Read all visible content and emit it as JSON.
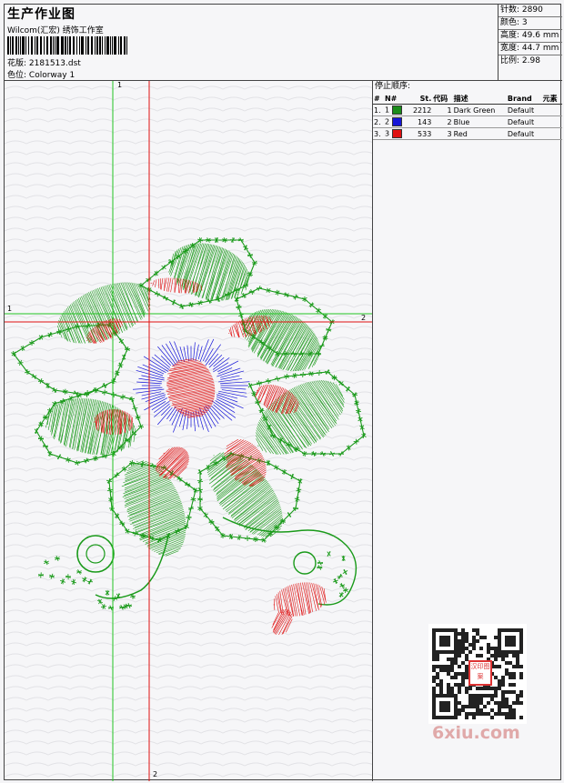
{
  "header": {
    "title": "生产作业图",
    "studio": "Wilcom(汇宏) 绣饰工作室",
    "design_label": "花版:",
    "design_file": "2181513.dst",
    "colorway_label": "色位:",
    "colorway": "Colorway 1"
  },
  "stats": [
    {
      "label": "针数:",
      "value": "2890"
    },
    {
      "label": "颜色:",
      "value": "3"
    },
    {
      "label": "高度:",
      "value": "49.6 mm"
    },
    {
      "label": "宽度:",
      "value": "44.7 mm"
    },
    {
      "label": "比例:",
      "value": "2.98"
    }
  ],
  "stop_sequence": {
    "title": "停止顺序:",
    "columns": [
      "#",
      "N#",
      "St.",
      "代码",
      "描述",
      "Brand",
      "元素"
    ],
    "rows": [
      {
        "index": "1.",
        "n": "1",
        "color": "#1a8c1a",
        "stitches": "2212",
        "code": "1",
        "desc": "Dark Green",
        "brand": "Default"
      },
      {
        "index": "2.",
        "n": "2",
        "color": "#1515d8",
        "stitches": "143",
        "code": "2",
        "desc": "Blue",
        "brand": "Default"
      },
      {
        "index": "3.",
        "n": "3",
        "color": "#e01010",
        "stitches": "533",
        "code": "3",
        "desc": "Red",
        "brand": "Default"
      }
    ]
  },
  "guides": {
    "green_v_label": "1",
    "green_h_label": "1",
    "red_v_label": "2",
    "red_h_label": "2"
  },
  "colors": {
    "green": "#1a9a1a",
    "blue": "#1515d8",
    "red": "#e01010"
  },
  "watermark": {
    "text": "6xiu.com",
    "badge": "汉印图案"
  }
}
